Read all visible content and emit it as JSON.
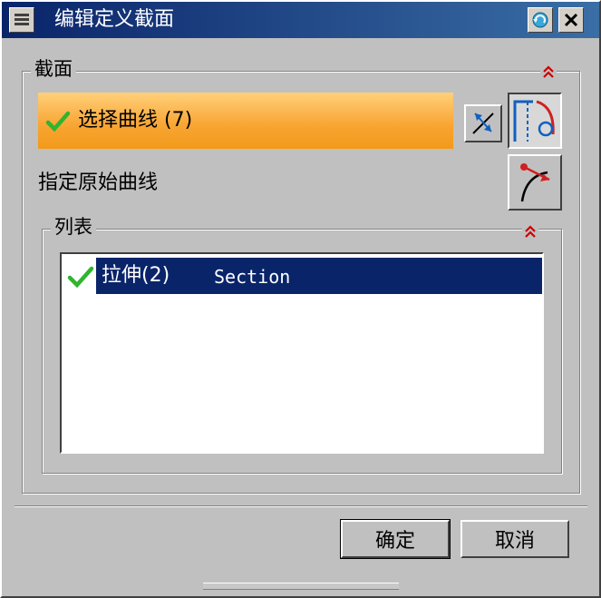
{
  "window": {
    "title": "编辑定义截面"
  },
  "section_group": {
    "title": "截面",
    "select_curve_label": "选择曲线 (7)",
    "specify_original_label": "指定原始曲线"
  },
  "list_group": {
    "title": "列表",
    "items": [
      {
        "name": "拉伸(2)",
        "type": "Section",
        "selected": true
      }
    ]
  },
  "buttons": {
    "ok": "确定",
    "cancel": "取消"
  },
  "colors": {
    "title_bar": "#0a246a",
    "selection_bar": "#f8a431",
    "list_selection": "#0a246a",
    "check": "#2fb52f",
    "collapse_chevron": "#cc0000"
  },
  "icons": [
    "menu-icon",
    "return-icon",
    "close-icon",
    "check-icon",
    "reverse-direction-icon",
    "curve-rule-icon",
    "original-curve-icon",
    "collapse-chevron-icon"
  ]
}
